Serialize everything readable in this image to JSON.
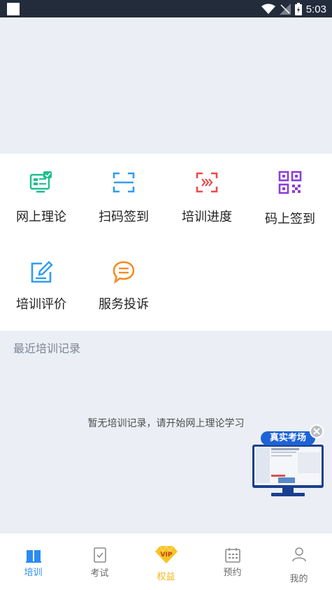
{
  "status_bar": {
    "time": "5:03"
  },
  "menu": {
    "items": [
      {
        "label": "网上理论",
        "icon": "monitor-check-icon"
      },
      {
        "label": "扫码签到",
        "icon": "scan-frame-icon"
      },
      {
        "label": "培训进度",
        "icon": "progress-arrows-icon"
      },
      {
        "label": "码上签到",
        "icon": "qr-code-icon"
      },
      {
        "label": "培训评价",
        "icon": "edit-note-icon"
      },
      {
        "label": "服务投诉",
        "icon": "chat-bubble-icon"
      }
    ]
  },
  "recent": {
    "title": "最近培训记录",
    "empty_text": "暂无培训记录，请开始网上理论学习"
  },
  "float_ad": {
    "label": "真实考场"
  },
  "tabbar": {
    "tabs": [
      {
        "label": "培训",
        "icon": "book-icon",
        "active": true
      },
      {
        "label": "考试",
        "icon": "exam-check-icon",
        "active": false
      },
      {
        "label": "权益",
        "icon": "vip-diamond-icon",
        "active": false
      },
      {
        "label": "预约",
        "icon": "calendar-icon",
        "active": false
      },
      {
        "label": "我的",
        "icon": "user-icon",
        "active": false
      }
    ]
  },
  "colors": {
    "active_tab": "#2b8cf0",
    "vip": "#f2b81a",
    "icon_green": "#1dbf8f",
    "icon_blue": "#2e9cf2",
    "icon_red": "#f0484a",
    "icon_purple": "#8a3ed8",
    "icon_orange": "#f58a1f"
  }
}
